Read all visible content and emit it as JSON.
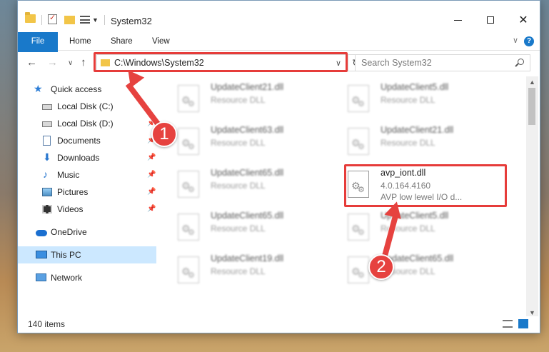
{
  "window": {
    "title": "System32"
  },
  "ribbon": {
    "tabs": [
      "File",
      "Home",
      "Share",
      "View"
    ]
  },
  "navigation": {
    "address": "C:\\Windows\\System32",
    "search_placeholder": "Search System32"
  },
  "sidebar": {
    "items": [
      {
        "label": "Quick access",
        "icon": "star-icon",
        "pinned": false
      },
      {
        "label": "Local Disk (C:)",
        "icon": "drive-icon",
        "pinned": false
      },
      {
        "label": "Local Disk (D:)",
        "icon": "drive-icon",
        "pinned": true
      },
      {
        "label": "Documents",
        "icon": "documents-icon",
        "pinned": true
      },
      {
        "label": "Downloads",
        "icon": "downloads-icon",
        "pinned": true
      },
      {
        "label": "Music",
        "icon": "music-icon",
        "pinned": true
      },
      {
        "label": "Pictures",
        "icon": "pictures-icon",
        "pinned": true
      },
      {
        "label": "Videos",
        "icon": "videos-icon",
        "pinned": true
      },
      {
        "label": "OneDrive",
        "icon": "onedrive-icon",
        "pinned": false
      },
      {
        "label": "This PC",
        "icon": "this-pc-icon",
        "pinned": false,
        "selected": true
      },
      {
        "label": "Network",
        "icon": "network-icon",
        "pinned": false
      }
    ]
  },
  "files": [
    {
      "name": "UpdateClient21.dll",
      "type": "Resource DLL"
    },
    {
      "name": "UpdateClient5.dll",
      "type": "Resource DLL"
    },
    {
      "name": "UpdateClient63.dll",
      "type": "Resource DLL"
    },
    {
      "name": "UpdateClient21.dll",
      "type": "Resource DLL"
    },
    {
      "name": "UpdateClient65.dll",
      "type": "Resource DLL"
    },
    {
      "name": "avp_iont.dll",
      "version": "4.0.164.4160",
      "description": "AVP low lewel I/O d..."
    },
    {
      "name": "UpdateClient65.dll",
      "type": "Resource DLL"
    },
    {
      "name": "UpdateClient5.dll",
      "type": "Resource DLL"
    },
    {
      "name": "UpdateClient19.dll",
      "type": "Resource DLL"
    },
    {
      "name": "UpdateClient65.dll",
      "type": "Resource DLL"
    }
  ],
  "status": {
    "item_count": "140 items"
  },
  "annotations": {
    "step1": "1",
    "step2": "2",
    "highlight_color": "#e63c3a"
  }
}
